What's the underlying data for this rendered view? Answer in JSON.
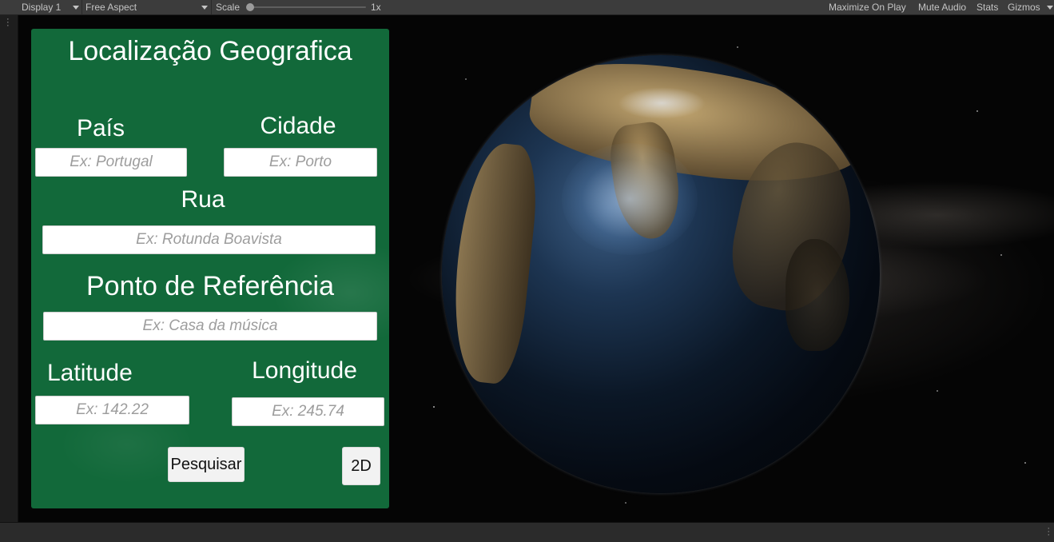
{
  "toolbar": {
    "display": "Display 1",
    "aspect": "Free Aspect",
    "scale_label": "Scale",
    "scale_value": "1x",
    "scale_fraction": 0.0,
    "maximize_on_play": "Maximize On Play",
    "mute_audio": "Mute Audio",
    "stats": "Stats",
    "gizmos": "Gizmos"
  },
  "panel": {
    "title": "Localização Geografica",
    "country": {
      "label": "País",
      "placeholder": "Ex: Portugal"
    },
    "city": {
      "label": "Cidade",
      "placeholder": "Ex: Porto"
    },
    "street": {
      "label": "Rua",
      "placeholder": "Ex: Rotunda Boavista"
    },
    "landmark": {
      "label": "Ponto de Referência",
      "placeholder": "Ex: Casa da música"
    },
    "latitude": {
      "label": "Latitude",
      "placeholder": "Ex: 142.22"
    },
    "longitude": {
      "label": "Longitude",
      "placeholder": "Ex: 245.74"
    },
    "search_button": "Pesquisar",
    "mode_button": "2D"
  },
  "colors": {
    "panel_green": "#12693a",
    "toolbar_bg": "#3c3c3c",
    "space_bg": "#050505"
  }
}
